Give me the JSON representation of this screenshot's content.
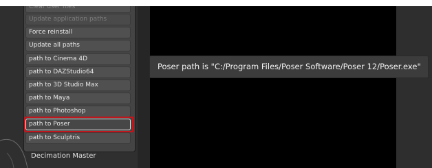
{
  "menu": {
    "items": [
      {
        "label": "Clear user files",
        "state": "clipped"
      },
      {
        "label": "Update application paths",
        "state": "disabled"
      },
      {
        "label": "Force reinstall",
        "state": "normal"
      },
      {
        "label": "Update all paths",
        "state": "normal"
      },
      {
        "label": "path to Cinema 4D",
        "state": "normal"
      },
      {
        "label": "path to DAZStudio64",
        "state": "normal"
      },
      {
        "label": "path to 3D Studio Max",
        "state": "normal"
      },
      {
        "label": "path to Maya",
        "state": "normal"
      },
      {
        "label": "path to Photoshop",
        "state": "normal"
      },
      {
        "label": "path to Poser",
        "state": "selected"
      },
      {
        "label": "path to Sculptris",
        "state": "normal"
      }
    ]
  },
  "section_label": "Decimation Master",
  "tooltip": {
    "text": "Poser path is \"C:/Program Files/Poser Software/Poser 12/Poser.exe\""
  },
  "colors": {
    "highlight_outline": "#c0161c",
    "panel": "#444444",
    "viewport": "#000000"
  }
}
